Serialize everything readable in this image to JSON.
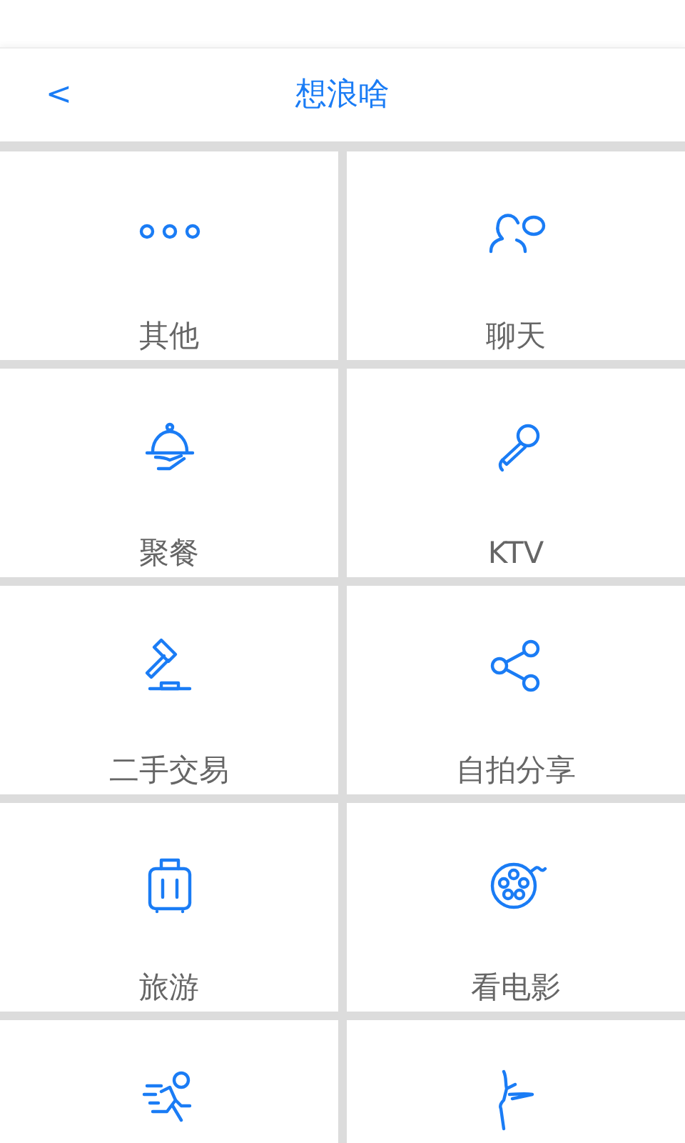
{
  "header": {
    "back": "<",
    "title": "想浪啥"
  },
  "items": [
    {
      "kind": "full",
      "label": "其他"
    },
    {
      "kind": "full",
      "label": "聊天"
    },
    {
      "kind": "full",
      "label": "聚餐"
    },
    {
      "kind": "full",
      "label": "KTV"
    },
    {
      "kind": "full",
      "label": "二手交易"
    },
    {
      "kind": "full",
      "label": "自拍分享"
    },
    {
      "kind": "full",
      "label": "旅游"
    },
    {
      "kind": "full",
      "label": "看电影"
    },
    {
      "kind": "cut"
    },
    {
      "kind": "cut"
    }
  ]
}
